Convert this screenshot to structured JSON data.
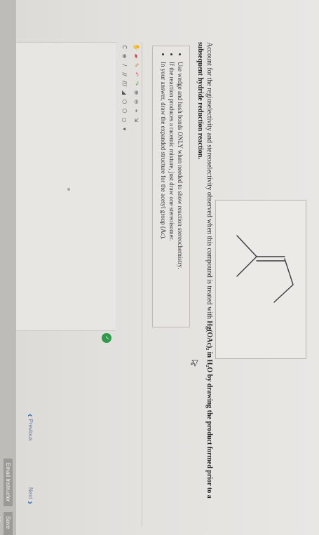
{
  "question": {
    "part1": "Account for the regioselectivity and stereoselectivity observed when this compound is treated with ",
    "reagent": "Hg(OAc)₂ in H₂O by drawing the product formed prior to a subsequent hydride reduction reaction.",
    "part2": ""
  },
  "instructions": [
    "Use wedge and hash bonds ONLY when needed to show reaction stereochemistry.",
    "If the reaction produces a racemic mixture, just draw one stereoisomer.",
    "In your answer, draw the expanded structure for the acetyl group (Ac)."
  ],
  "editor": {
    "row1_icons": [
      "hand-icon",
      "eraser-icon",
      "pencil-icon",
      "undo-icon",
      "redo-icon",
      "zoom-in-icon",
      "zoom-out-icon",
      "clean-icon",
      "scale-icon"
    ],
    "row2_icons": [
      "charge-icon",
      "plus-icon",
      "line-icon",
      "double-line-icon",
      "triple-line-icon",
      "wedge-icon",
      "ring-icon",
      "ring-icon",
      "ring-icon",
      "dropdown-icon"
    ],
    "badge": "✓"
  },
  "nav": {
    "previous": "Previous",
    "next": "Next"
  },
  "footer": {
    "email": "Email Instructor",
    "save": "Save an"
  },
  "colors": {
    "accent": "#2d6ab8",
    "badge": "#2e9a4b"
  }
}
